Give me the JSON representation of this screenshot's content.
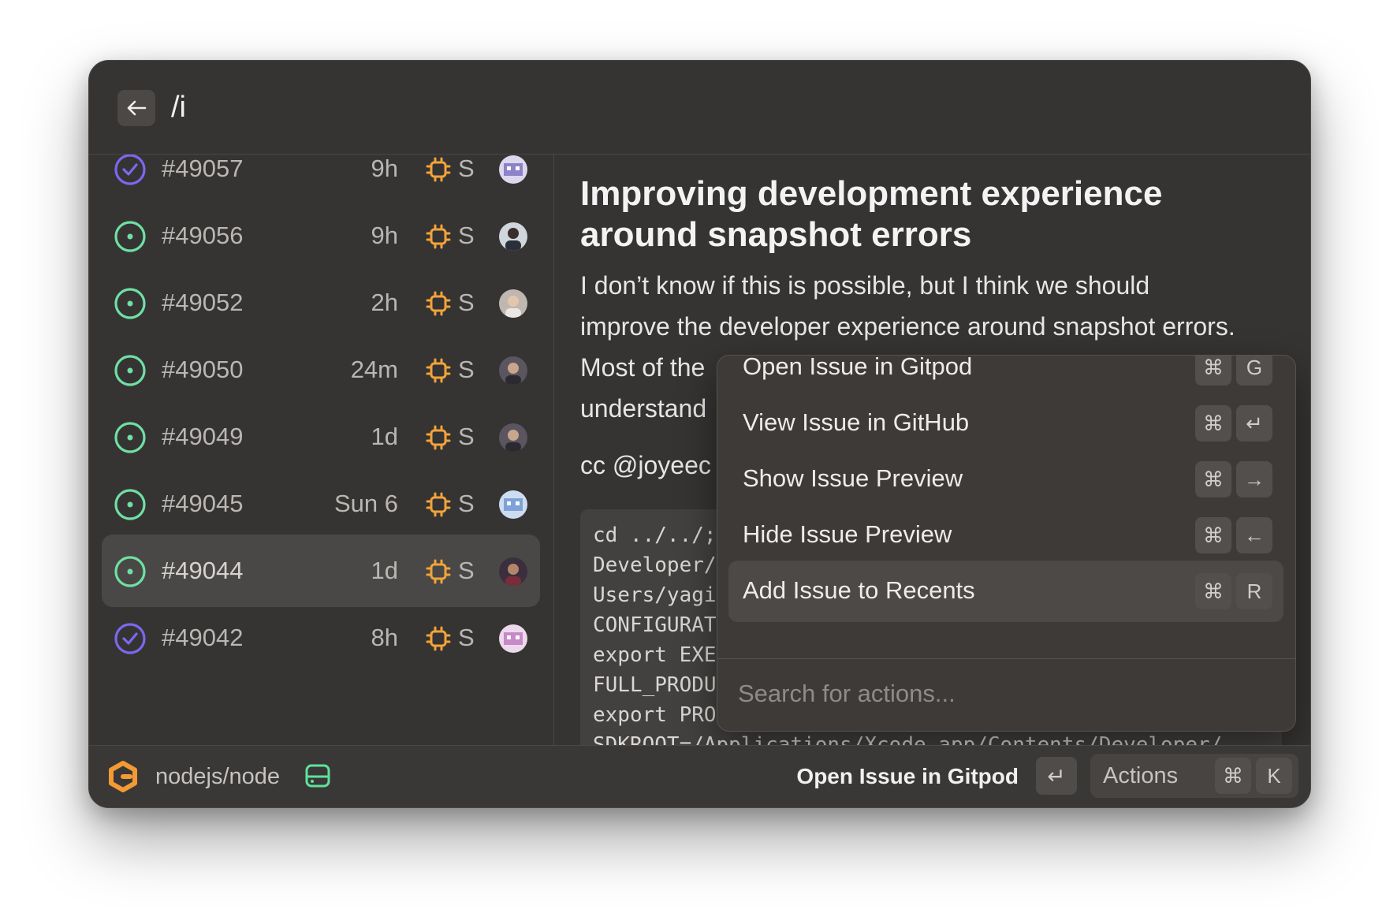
{
  "header": {
    "query": "/i"
  },
  "issues": [
    {
      "number": "#49057",
      "age": "9h",
      "size": "S",
      "state": "closed",
      "selected": false
    },
    {
      "number": "#49056",
      "age": "9h",
      "size": "S",
      "state": "open",
      "selected": false
    },
    {
      "number": "#49052",
      "age": "2h",
      "size": "S",
      "state": "open",
      "selected": false
    },
    {
      "number": "#49050",
      "age": "24m",
      "size": "S",
      "state": "open",
      "selected": false
    },
    {
      "number": "#49049",
      "age": "1d",
      "size": "S",
      "state": "open",
      "selected": false
    },
    {
      "number": "#49045",
      "age": "Sun 6",
      "size": "S",
      "state": "open",
      "selected": false
    },
    {
      "number": "#49044",
      "age": "1d",
      "size": "S",
      "state": "open",
      "selected": true
    },
    {
      "number": "#49042",
      "age": "8h",
      "size": "S",
      "state": "closed",
      "selected": false
    }
  ],
  "detail": {
    "title": "Improving development experience around snapshot errors",
    "body_line1": "I don’t know if this is possible, but I think we should",
    "body_line2": "improve the developer experience around snapshot errors.",
    "body_line3": "Most of the",
    "body_line4": "understand",
    "cc": "cc @joyeec",
    "code": "cd ../../;\nDeveloper/\nUsers/yagi\nCONFIGURAT\nexport EXE\nFULL_PRODU\nexport PRO\nSDKROOT=/Applications/Xcode.app/Contents/Developer/"
  },
  "actions_menu": {
    "items": [
      {
        "label": "Open Issue in Gitpod",
        "keys": [
          "⌘",
          "G"
        ],
        "selected": false
      },
      {
        "label": "View Issue in GitHub",
        "keys": [
          "⌘",
          "↵"
        ],
        "selected": false
      },
      {
        "label": "Show Issue Preview",
        "keys": [
          "⌘",
          "→"
        ],
        "selected": false
      },
      {
        "label": "Hide Issue Preview",
        "keys": [
          "⌘",
          "←"
        ],
        "selected": false
      },
      {
        "label": "Add Issue to Recents",
        "keys": [
          "⌘",
          "R"
        ],
        "selected": true
      }
    ],
    "search_placeholder": "Search for actions..."
  },
  "footer": {
    "repo": "nodejs/node",
    "primary_action": "Open Issue in Gitpod",
    "primary_key": "↵",
    "actions_label": "Actions",
    "actions_keys": [
      "⌘",
      "K"
    ]
  },
  "colors": {
    "open_status": "#6fe0a4",
    "closed_status": "#7b68f0",
    "processor_icon": "#f2a33a",
    "logo_orange": "#f49a33",
    "drive_icon": "#5ee39a"
  }
}
